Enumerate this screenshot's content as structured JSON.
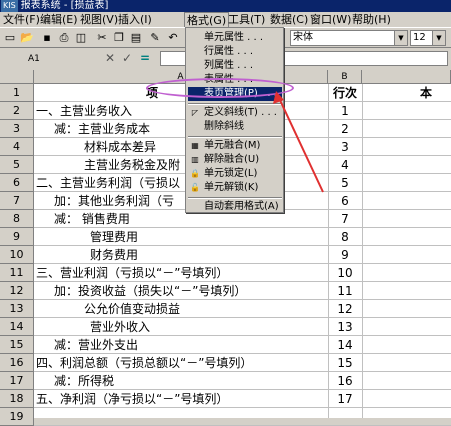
{
  "window": {
    "logo": "KIS",
    "title": "报表系统 - [损益表]"
  },
  "menubar": {
    "items": [
      "文件(F)",
      "编辑(E)",
      "视图(V)",
      "插入(I)",
      "格式(G)",
      "工具(T)",
      "数据(C)",
      "窗口(W)",
      "帮助(H)"
    ]
  },
  "toolbar": {
    "font_name": "宋体",
    "font_size": "12"
  },
  "formula_bar": {
    "cell_ref": "A1",
    "cancel": "✕",
    "confirm": "✓",
    "equals": "="
  },
  "sheet": {
    "columns": [
      "A",
      "B"
    ],
    "col_c_partial": "本",
    "rows": [
      {
        "num": "1",
        "a": "项",
        "b": "行次"
      },
      {
        "num": "2",
        "a": "一、主营业务收入",
        "b": "1"
      },
      {
        "num": "3",
        "a": "减：主营业务成本",
        "b": "2"
      },
      {
        "num": "4",
        "a": "材料成本差异",
        "b": "3"
      },
      {
        "num": "5",
        "a": "主营业务税金及附",
        "b": "4"
      },
      {
        "num": "6",
        "a": "二、主营业务利润（亏损以",
        "b": "5"
      },
      {
        "num": "7",
        "a": "加：其他业务利润（亏",
        "b": "6"
      },
      {
        "num": "8",
        "a": "减：  销售费用",
        "b": "7"
      },
      {
        "num": "9",
        "a": "管理费用",
        "b": "8"
      },
      {
        "num": "10",
        "a": "财务费用",
        "b": "9"
      },
      {
        "num": "11",
        "a": "三、营业利润（亏损以“－”号填列）",
        "b": "10"
      },
      {
        "num": "12",
        "a": "加：投资收益（损失以“－”号填列）",
        "b": "11"
      },
      {
        "num": "13",
        "a": "公允价值变动损益",
        "b": "12"
      },
      {
        "num": "14",
        "a": "营业外收入",
        "b": "13"
      },
      {
        "num": "15",
        "a": "减：营业外支出",
        "b": "14"
      },
      {
        "num": "16",
        "a": "四、利润总额（亏损总额以“－”号填列）",
        "b": "15"
      },
      {
        "num": "17",
        "a": "减：所得税",
        "b": "16"
      },
      {
        "num": "18",
        "a": "五、净利润（净亏损以“－”号填列）",
        "b": "17"
      },
      {
        "num": "19",
        "a": "",
        "b": ""
      }
    ]
  },
  "format_menu": {
    "items": [
      {
        "label": "单元属性 . . .",
        "icon": ""
      },
      {
        "label": "行属性 . . .",
        "icon": ""
      },
      {
        "label": "列属性 . . .",
        "icon": ""
      },
      {
        "label": "表属性 . . .",
        "icon": ""
      },
      {
        "label": "表页管理(P) . . .",
        "icon": "",
        "highlighted": true
      },
      {
        "label": "定义斜线(T) . . .",
        "icon": "diagonal-icon"
      },
      {
        "label": "删除斜线",
        "icon": ""
      },
      {
        "label": "单元融合(M)",
        "icon": "merge-icon"
      },
      {
        "label": "解除融合(U)",
        "icon": "unmerge-icon"
      },
      {
        "label": "单元锁定(L)",
        "icon": "lock-icon"
      },
      {
        "label": "单元解锁(K)",
        "icon": "unlock-icon"
      },
      {
        "label": "自动套用格式(A)",
        "icon": ""
      }
    ]
  },
  "annotation_color": "#c060d0",
  "arrow_color": "#e03030"
}
